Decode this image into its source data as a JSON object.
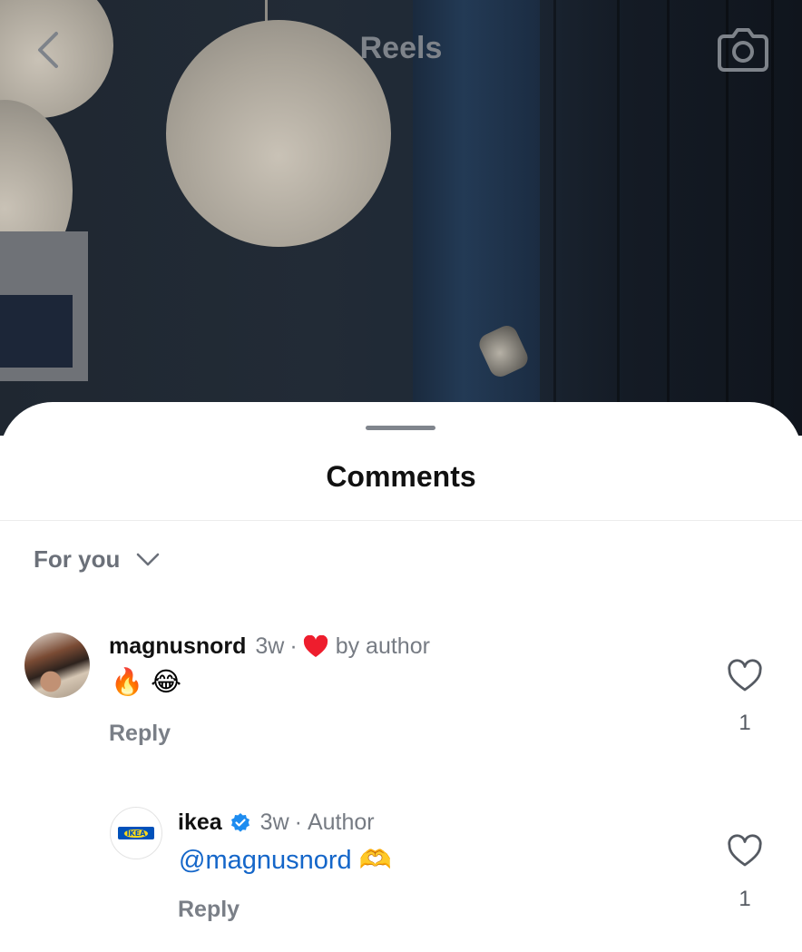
{
  "header": {
    "title": "Reels"
  },
  "sheet": {
    "title": "Comments",
    "filter_label": "For you"
  },
  "comments": [
    {
      "username": "magnusnord",
      "time": "3w",
      "separator": "·",
      "liked_by_author_label": "by author",
      "text": "🔥 😂",
      "reply_label": "Reply",
      "like_count": "1"
    },
    {
      "username": "ikea",
      "verified": true,
      "time": "3w",
      "separator": "·",
      "role": "Author",
      "mention": "@magnusnord",
      "emoji": "🫶",
      "reply_label": "Reply",
      "like_count": "1",
      "avatar_logo_text": "IKEA"
    }
  ],
  "colors": {
    "mention": "#1466c9",
    "verified_badge": "#1d8cf0",
    "heart_red": "#ee1d2d",
    "secondary_text": "#767b83"
  }
}
